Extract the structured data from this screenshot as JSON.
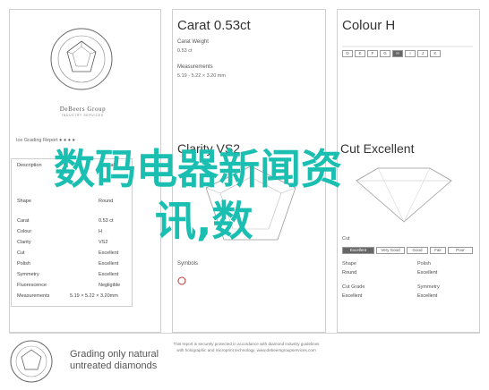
{
  "left": {
    "brand": "DeBeers Group",
    "brand_sub": "INDUSTRY SERVICES",
    "summary_head": "Ice Grading Report  ● ● ● ●",
    "rows": [
      {
        "label": "Description",
        "value": "Natural"
      },
      {
        "label": "Shape",
        "value": "Round"
      },
      {
        "label": "Carat",
        "value": "0.53 ct"
      },
      {
        "label": "Colour",
        "value": "H"
      },
      {
        "label": "Clarity",
        "value": "VS2"
      },
      {
        "label": "Cut",
        "value": "Excellent"
      },
      {
        "label": "Polish",
        "value": "Excellent"
      },
      {
        "label": "Symmetry",
        "value": "Excellent"
      },
      {
        "label": "Fluorescence",
        "value": "Negligible"
      }
    ],
    "extra_rows": [
      {
        "label": "Measurements",
        "value": "5.19 × 5.22 × 3.20mm"
      }
    ]
  },
  "middle": {
    "title": "Carat  0.53ct",
    "carat_weight_label": "Carat Weight",
    "carat_weight_value": "0.53 ct",
    "measurements_label": "Measurements",
    "measurements_value": "5.19 - 5.22 × 3.20 mm",
    "clarity_title": "Clarity  VS2",
    "symbols_label": "Symbols"
  },
  "right": {
    "title": "Colour  H",
    "grades": [
      "D",
      "E",
      "F",
      "G",
      "H",
      "I",
      "J",
      "K"
    ],
    "selected_grade": "H",
    "cut_title": "Cut  Excellent",
    "cut_bar": [
      "Excellent",
      "Very Good",
      "Good",
      "Fair",
      "Poor"
    ],
    "selected_cut": "Excellent",
    "shape_label": "Shape",
    "shape_value": "Round",
    "polish_label": "Polish",
    "polish_value": "Excellent",
    "cutgrade_label": "Cut Grade",
    "cutgrade_value": "Excellent",
    "symmetry_label": "Symmetry",
    "symmetry_value": "Excellent",
    "cut_section": "Cut"
  },
  "footer": {
    "title_line1": "Grading only natural",
    "title_line2": "untreated diamonds",
    "note": "This report is securely protected in accordance with diamond industry guidelines with holographic and microprint technology. www.debeersgroupservices.com"
  },
  "headline": {
    "line1": "数码电器新闻资",
    "line2": "讯,数"
  },
  "colors": {
    "headline": "#1bbfb2",
    "frame": "#cfcfcf"
  }
}
